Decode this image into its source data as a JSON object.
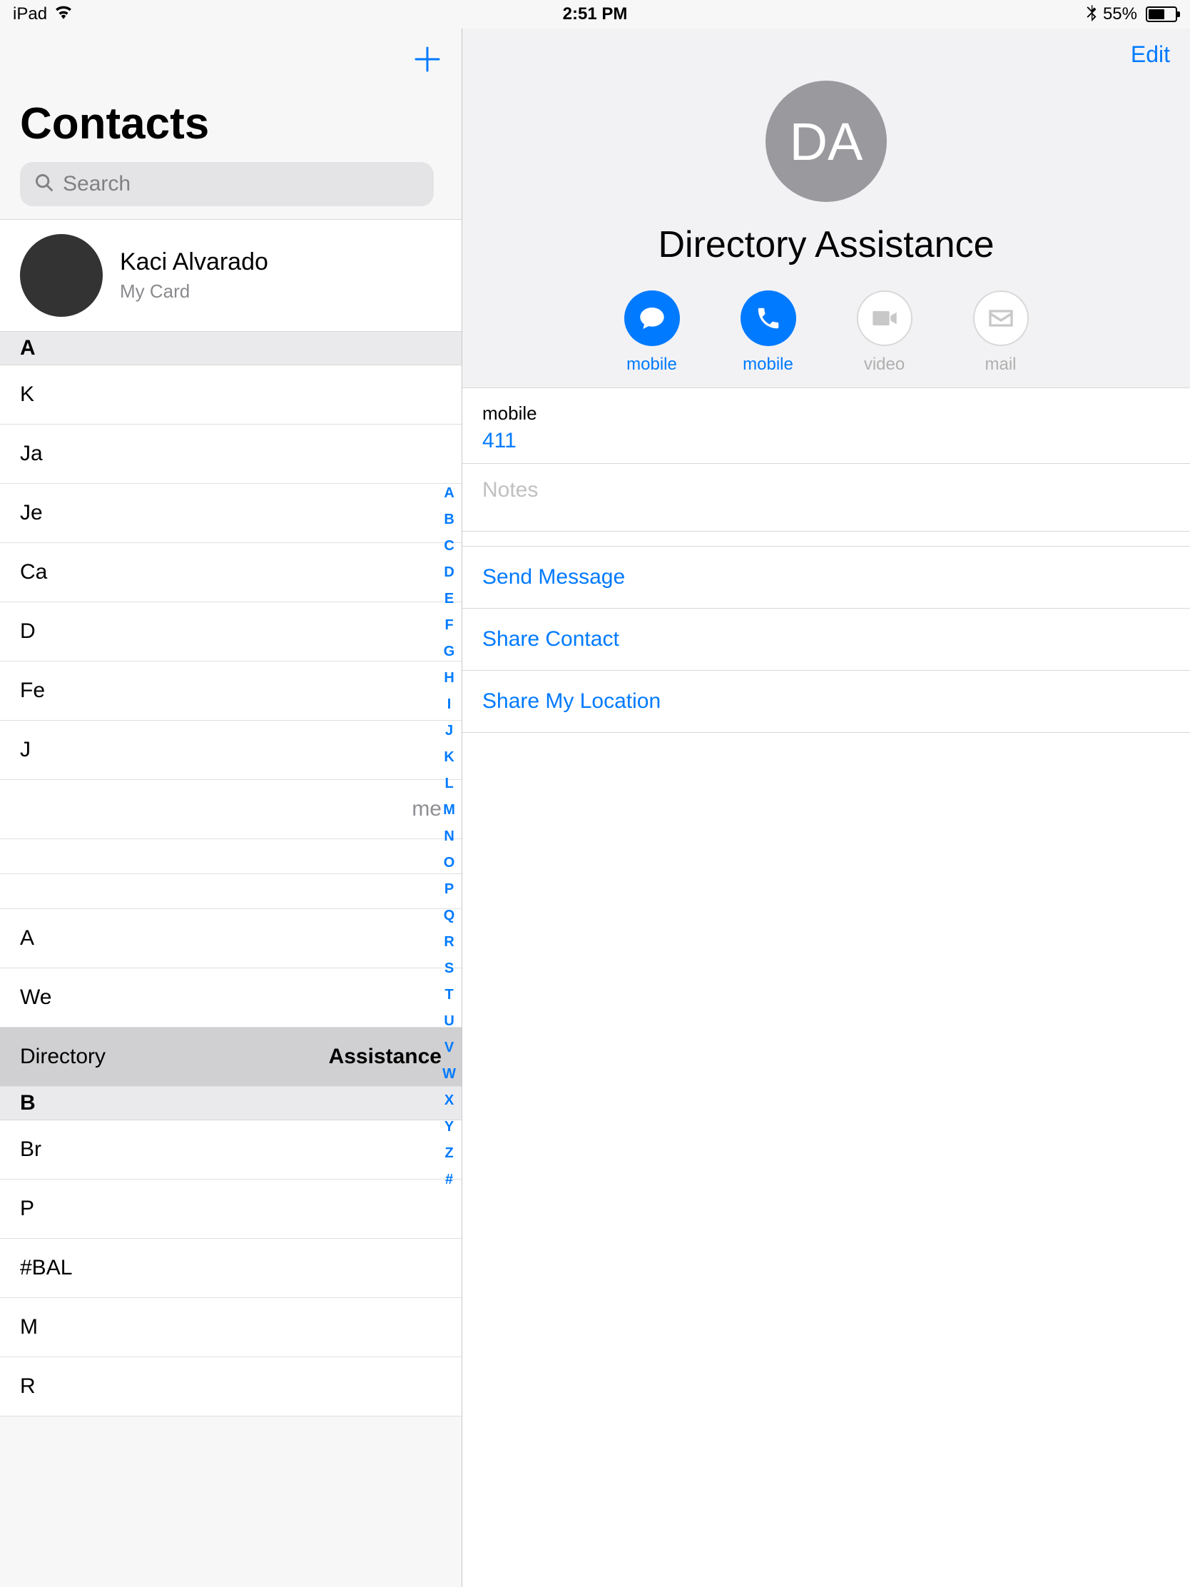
{
  "status": {
    "device": "iPad",
    "time": "2:51 PM",
    "battery_pct": "55%"
  },
  "sidebar": {
    "title": "Contacts",
    "search_placeholder": "Search",
    "my_card": {
      "name": "Kaci Alvarado",
      "sub": "My Card"
    },
    "sections": [
      {
        "letter": "A",
        "rows": [
          {
            "prefix": "K",
            "redacted": true,
            "me": false
          },
          {
            "prefix": "Ja",
            "redacted": true,
            "me": false
          },
          {
            "prefix": "Je",
            "redacted": true,
            "me": false
          },
          {
            "prefix": "Ca",
            "redacted": true,
            "me": false
          },
          {
            "prefix": "D",
            "redacted": true,
            "me": false
          },
          {
            "prefix": "Fe",
            "redacted": true,
            "me": false
          },
          {
            "prefix": "J",
            "redacted": true,
            "me": false
          },
          {
            "prefix": "",
            "redacted": true,
            "me": true,
            "me_text": "me"
          },
          {
            "prefix": "",
            "redacted": true,
            "me": false
          },
          {
            "prefix": "",
            "redacted": true,
            "me": false
          },
          {
            "prefix": "A",
            "redacted": true,
            "me": false
          },
          {
            "prefix": "We",
            "redacted": true,
            "me": false
          },
          {
            "first": "Directory ",
            "last": "Assistance",
            "selected": true
          }
        ]
      },
      {
        "letter": "B",
        "rows": [
          {
            "prefix": "Br",
            "redacted": true,
            "me": false
          },
          {
            "prefix": "P",
            "redacted": true,
            "me": false
          },
          {
            "prefix": "#BAL",
            "redacted": false,
            "me": false
          },
          {
            "prefix": "M",
            "redacted": true,
            "me": false
          },
          {
            "prefix": "R",
            "redacted": true,
            "me": false
          }
        ]
      }
    ],
    "index": [
      "A",
      "B",
      "C",
      "D",
      "E",
      "F",
      "G",
      "H",
      "I",
      "J",
      "K",
      "L",
      "M",
      "N",
      "O",
      "P",
      "Q",
      "R",
      "S",
      "T",
      "U",
      "V",
      "W",
      "X",
      "Y",
      "Z",
      "#"
    ]
  },
  "detail": {
    "edit": "Edit",
    "initials": "DA",
    "name": "Directory Assistance",
    "actions": {
      "message": "mobile",
      "call": "mobile",
      "video": "video",
      "mail": "mail"
    },
    "fields": [
      {
        "label": "mobile",
        "value": "411"
      }
    ],
    "notes_placeholder": "Notes",
    "links": [
      "Send Message",
      "Share Contact",
      "Share My Location"
    ]
  }
}
